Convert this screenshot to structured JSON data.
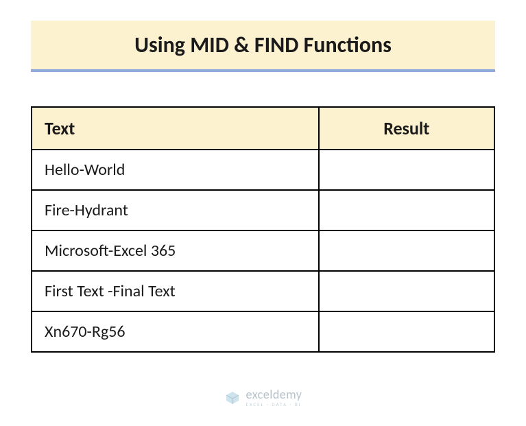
{
  "title": "Using MID & FIND Functions",
  "table": {
    "headers": {
      "text": "Text",
      "result": "Result"
    },
    "rows": [
      {
        "text": "Hello-World",
        "result": ""
      },
      {
        "text": "Fire-Hydrant",
        "result": ""
      },
      {
        "text": "Microsoft-Excel 365",
        "result": ""
      },
      {
        "text": "First Text -Final Text",
        "result": ""
      },
      {
        "text": "Xn670-Rg56",
        "result": ""
      }
    ]
  },
  "watermark": {
    "brand": "exceldemy",
    "tagline": "EXCEL · DATA · BI"
  }
}
